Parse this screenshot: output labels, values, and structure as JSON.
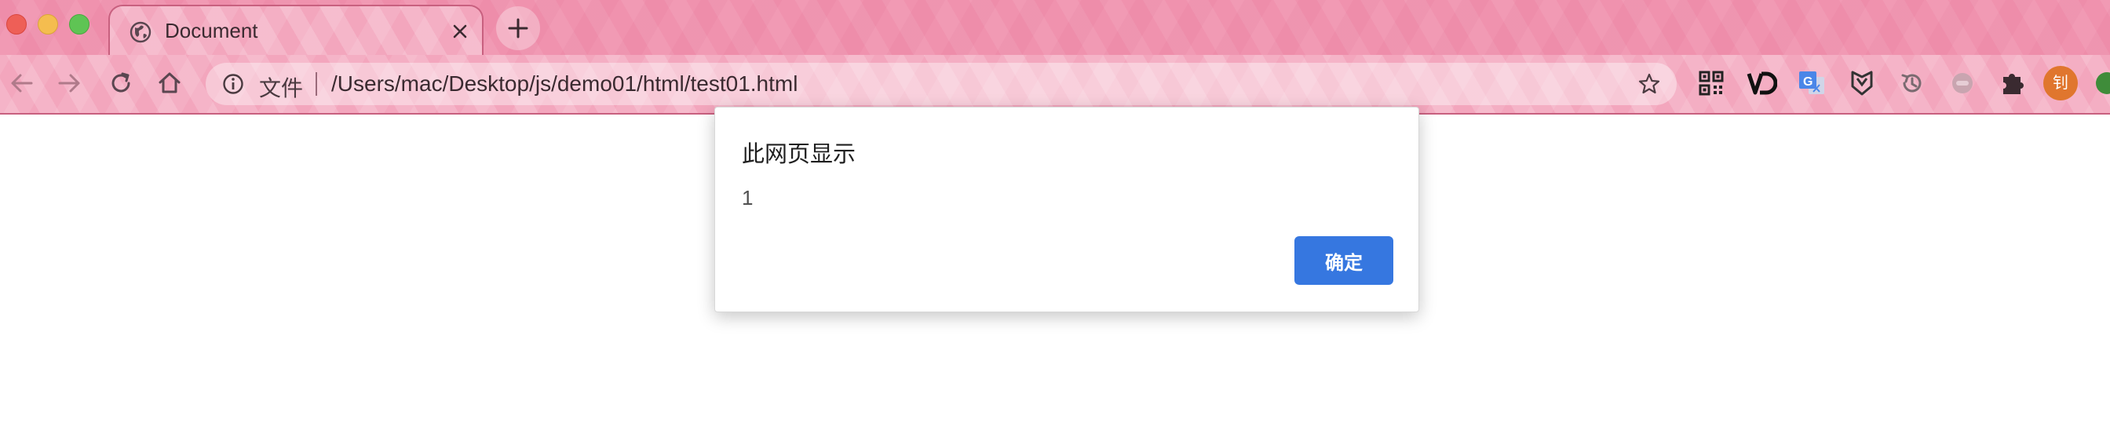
{
  "browser": {
    "tab": {
      "title": "Document",
      "favicon": "globe-icon"
    },
    "new_tab_icon": "plus-icon",
    "toolbar": {
      "back_icon": "arrow-left-icon",
      "forward_icon": "arrow-right-icon",
      "reload_icon": "reload-icon",
      "home_icon": "home-icon",
      "security_label": "文件",
      "url": "/Users/mac/Desktop/js/demo01/html/test01.html",
      "bookmark_icon": "star-icon",
      "extensions": [
        "qr-code-icon",
        "vd-extension-icon",
        "translate-icon",
        "shield-extension-icon",
        "history-icon",
        "disabled-extension-icon",
        "puzzle-icon"
      ],
      "profile_initial": "钊"
    }
  },
  "dialog": {
    "title": "此网页显示",
    "message": "1",
    "ok_label": "确定"
  },
  "colors": {
    "chrome_pink": "#f092ae",
    "toolbar_pink": "#f3a6bd",
    "primary_button": "#3677e0",
    "avatar": "#e0762e"
  }
}
